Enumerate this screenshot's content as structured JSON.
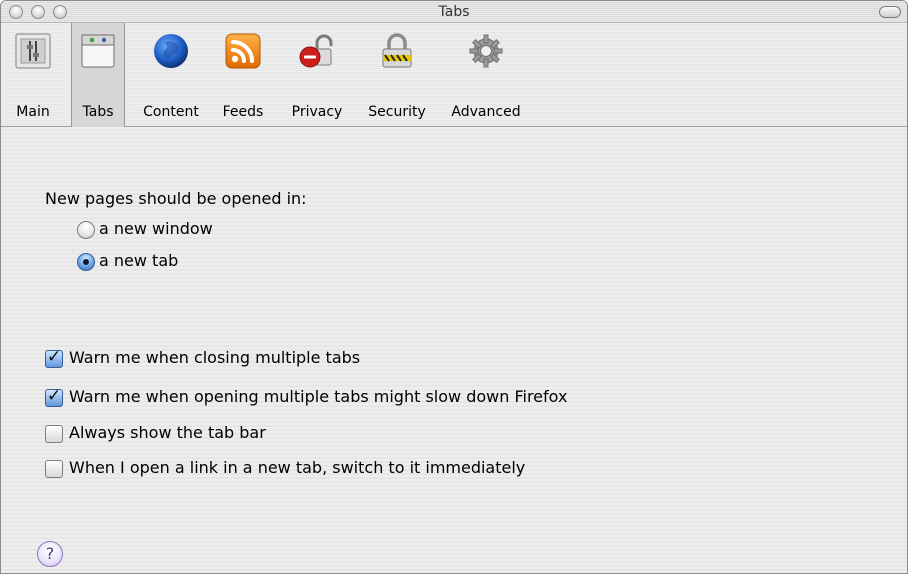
{
  "window": {
    "title": "Tabs"
  },
  "toolbar": {
    "items": [
      {
        "label": "Main",
        "icon": "main-switch-icon"
      },
      {
        "label": "Tabs",
        "icon": "tabs-window-icon",
        "selected": true
      },
      {
        "label": "Content",
        "icon": "globe-icon"
      },
      {
        "label": "Feeds",
        "icon": "rss-feed-icon"
      },
      {
        "label": "Privacy",
        "icon": "privacy-lock-icon"
      },
      {
        "label": "Security",
        "icon": "security-padlock-icon"
      },
      {
        "label": "Advanced",
        "icon": "gear-icon"
      }
    ]
  },
  "tabs_prefs": {
    "open_new_pages_label": "New pages should be opened in:",
    "options": [
      {
        "label": "a new window",
        "selected": false
      },
      {
        "label": "a new tab",
        "selected": true
      }
    ],
    "checkboxes": [
      {
        "label": "Warn me when closing multiple tabs",
        "checked": true
      },
      {
        "label": "Warn me when opening multiple tabs might slow down Firefox",
        "checked": true
      },
      {
        "label": "Always show the tab bar",
        "checked": false
      },
      {
        "label": "When I open a link in a new tab, switch to it immediately",
        "checked": false
      }
    ],
    "help": "?"
  }
}
